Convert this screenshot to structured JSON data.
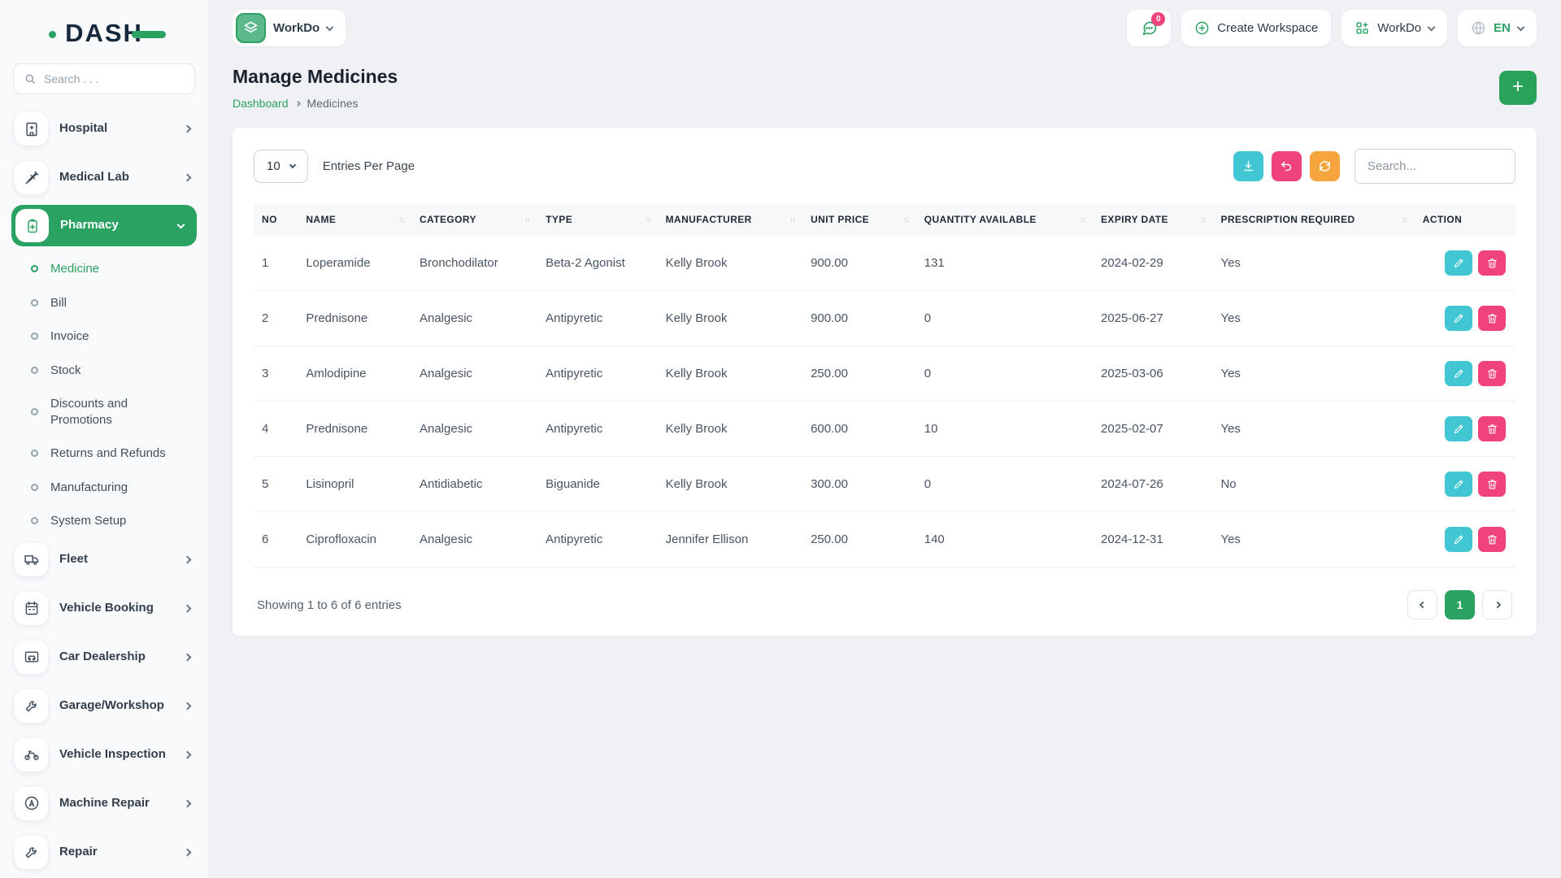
{
  "brand": {
    "logo_text": "DASH"
  },
  "sidebar": {
    "search_placeholder": "Search . . .",
    "items": [
      {
        "type": "main",
        "label": "Hospital",
        "icon": "hospital-icon",
        "chevron": "right"
      },
      {
        "type": "main",
        "label": "Medical Lab",
        "icon": "syringe-icon",
        "chevron": "right"
      },
      {
        "type": "main",
        "label": "Pharmacy",
        "icon": "pharmacy-icon",
        "chevron": "down",
        "active": true
      },
      {
        "type": "sub",
        "label": "Medicine",
        "active": true
      },
      {
        "type": "sub",
        "label": "Bill"
      },
      {
        "type": "sub",
        "label": "Invoice"
      },
      {
        "type": "sub",
        "label": "Stock"
      },
      {
        "type": "sub",
        "label": "Discounts and Promotions"
      },
      {
        "type": "sub",
        "label": "Returns and Refunds"
      },
      {
        "type": "sub",
        "label": "Manufacturing"
      },
      {
        "type": "sub",
        "label": "System Setup"
      },
      {
        "type": "main",
        "label": "Fleet",
        "icon": "fleet-icon",
        "chevron": "right"
      },
      {
        "type": "main",
        "label": "Vehicle Booking",
        "icon": "calendar-icon",
        "chevron": "right"
      },
      {
        "type": "main",
        "label": "Car Dealership",
        "icon": "car-icon",
        "chevron": "right"
      },
      {
        "type": "main",
        "label": "Garage/Workshop",
        "icon": "wrench-icon",
        "chevron": "right"
      },
      {
        "type": "main",
        "label": "Vehicle Inspection",
        "icon": "motorcycle-icon",
        "chevron": "right"
      },
      {
        "type": "main",
        "label": "Machine Repair",
        "icon": "machine-icon",
        "chevron": "right"
      },
      {
        "type": "main",
        "label": "Repair",
        "icon": "wrench-icon",
        "chevron": "right"
      }
    ]
  },
  "topbar": {
    "workspace_name": "WorkDo",
    "chat_badge": "0",
    "create_workspace_label": "Create Workspace",
    "workdo_menu_label": "WorkDo",
    "language_label": "EN"
  },
  "page": {
    "title": "Manage Medicines",
    "breadcrumb_home": "Dashboard",
    "breadcrumb_current": "Medicines"
  },
  "toolbar": {
    "entries_value": "10",
    "entries_label": "Entries Per Page",
    "search_placeholder": "Search..."
  },
  "table": {
    "columns": [
      {
        "label": "NO",
        "sortable": false
      },
      {
        "label": "NAME",
        "sortable": true
      },
      {
        "label": "CATEGORY",
        "sortable": true
      },
      {
        "label": "TYPE",
        "sortable": true
      },
      {
        "label": "MANUFACTURER",
        "sortable": true
      },
      {
        "label": "UNIT PRICE",
        "sortable": true
      },
      {
        "label": "QUANTITY AVAILABLE",
        "sortable": true
      },
      {
        "label": "EXPIRY DATE",
        "sortable": true
      },
      {
        "label": "PRESCRIPTION REQUIRED",
        "sortable": true
      },
      {
        "label": "ACTION",
        "sortable": false
      }
    ],
    "rows": [
      {
        "no": "1",
        "name": "Loperamide",
        "category": "Bronchodilator",
        "type": "Beta-2 Agonist",
        "manufacturer": "Kelly Brook",
        "unit_price": "900.00",
        "quantity": "131",
        "expiry": "2024-02-29",
        "prescription": "Yes"
      },
      {
        "no": "2",
        "name": "Prednisone",
        "category": "Analgesic",
        "type": "Antipyretic",
        "manufacturer": "Kelly Brook",
        "unit_price": "900.00",
        "quantity": "0",
        "expiry": "2025-06-27",
        "prescription": "Yes"
      },
      {
        "no": "3",
        "name": "Amlodipine",
        "category": "Analgesic",
        "type": "Antipyretic",
        "manufacturer": "Kelly Brook",
        "unit_price": "250.00",
        "quantity": "0",
        "expiry": "2025-03-06",
        "prescription": "Yes"
      },
      {
        "no": "4",
        "name": "Prednisone",
        "category": "Analgesic",
        "type": "Antipyretic",
        "manufacturer": "Kelly Brook",
        "unit_price": "600.00",
        "quantity": "10",
        "expiry": "2025-02-07",
        "prescription": "Yes"
      },
      {
        "no": "5",
        "name": "Lisinopril",
        "category": "Antidiabetic",
        "type": "Biguanide",
        "manufacturer": "Kelly Brook",
        "unit_price": "300.00",
        "quantity": "0",
        "expiry": "2024-07-26",
        "prescription": "No"
      },
      {
        "no": "6",
        "name": "Ciprofloxacin",
        "category": "Analgesic",
        "type": "Antipyretic",
        "manufacturer": "Jennifer Ellison",
        "unit_price": "250.00",
        "quantity": "140",
        "expiry": "2024-12-31",
        "prescription": "Yes"
      }
    ]
  },
  "footer": {
    "showing_text": "Showing 1 to 6 of 6 entries",
    "current_page": "1"
  },
  "icons": {
    "plus_glyph": "+",
    "sort_glyph": "↑↓"
  },
  "colors": {
    "accent_green": "#2aa262",
    "teal_button": "#41c6d3",
    "pink_button": "#f0437c",
    "orange_button": "#f6a43d",
    "badge_pink": "#f0437c"
  }
}
